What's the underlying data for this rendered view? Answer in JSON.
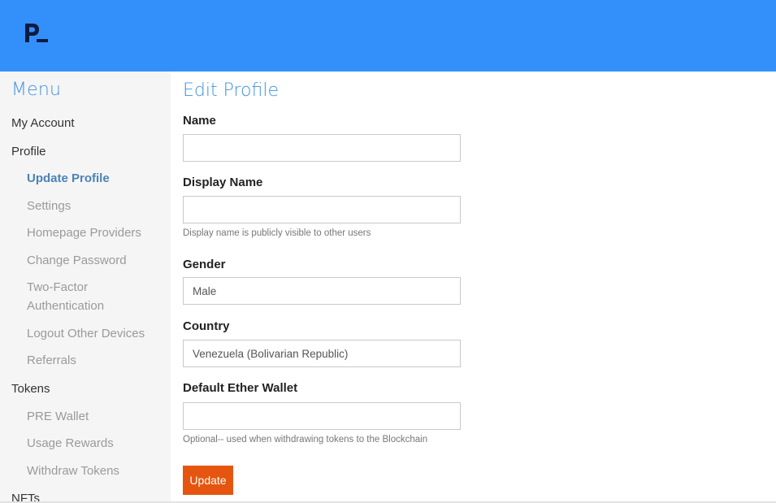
{
  "colors": {
    "header_bg": "#3390fb",
    "accent": "#3f93e0",
    "button_bg": "#e6550f",
    "sidebar_bg": "#f5f5f5"
  },
  "brand": {
    "logo_icon": "logo-p-icon"
  },
  "sidebar": {
    "title": "Menu",
    "items": [
      {
        "label": "My Account",
        "level": 0
      },
      {
        "label": "Profile",
        "level": 0
      },
      {
        "label": "Update Profile",
        "level": 1,
        "active": true
      },
      {
        "label": "Settings",
        "level": 1
      },
      {
        "label": "Homepage Providers",
        "level": 1
      },
      {
        "label": "Change Password",
        "level": 1
      },
      {
        "label": "Two-Factor Authentication",
        "level": 1
      },
      {
        "label": "Logout Other Devices",
        "level": 1
      },
      {
        "label": "Referrals",
        "level": 1
      },
      {
        "label": "Tokens",
        "level": 0
      },
      {
        "label": "PRE Wallet",
        "level": 1
      },
      {
        "label": "Usage Rewards",
        "level": 1
      },
      {
        "label": "Withdraw Tokens",
        "level": 1
      },
      {
        "label": "NFTs",
        "level": 0
      }
    ]
  },
  "form": {
    "title": "Edit Profile",
    "name": {
      "label": "Name",
      "value": ""
    },
    "display_name": {
      "label": "Display Name",
      "value": "",
      "hint": "Display name is publicly visible to other users"
    },
    "gender": {
      "label": "Gender",
      "value": "Male"
    },
    "country": {
      "label": "Country",
      "value": "Venezuela (Bolivarian Republic)"
    },
    "wallet": {
      "label": "Default Ether Wallet",
      "value": "",
      "hint": "Optional-- used when withdrawing tokens to the Blockchain"
    },
    "submit_label": "Update"
  }
}
